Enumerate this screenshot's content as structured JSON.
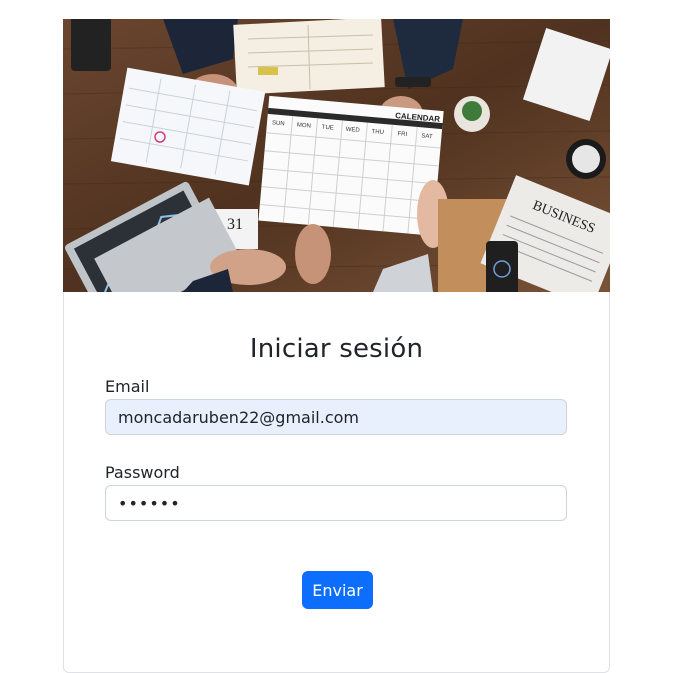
{
  "hero": {
    "calendar_heading": "CALENDAR",
    "calendar_days": [
      "SUN",
      "MON",
      "TUE",
      "WED",
      "THU",
      "FRI",
      "SAT"
    ],
    "desk_calendar_number": "31",
    "newspaper_heading": "BUSINESS"
  },
  "form": {
    "title": "Iniciar sesión",
    "email_label": "Email",
    "email_value": "moncadaruben22@gmail.com",
    "password_label": "Password",
    "password_value": "••••••",
    "submit_label": "Enviar"
  },
  "colors": {
    "primary": "#0d6efd",
    "autofill_bg": "#e8f0fe",
    "border": "#ced4da"
  }
}
